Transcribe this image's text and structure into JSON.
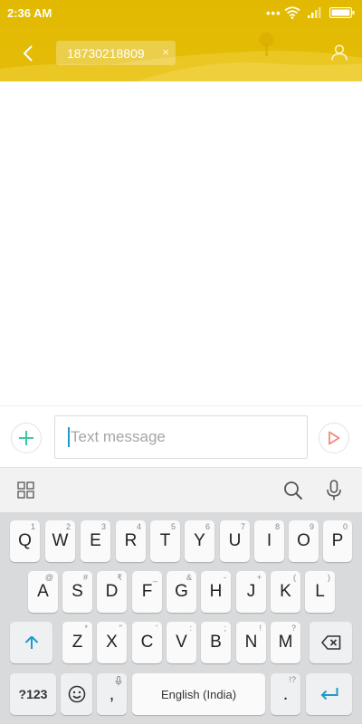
{
  "status_bar": {
    "time": "2:36 AM",
    "dots": "•••"
  },
  "header": {
    "recipient": "18730218809",
    "remove_symbol": "×"
  },
  "composer": {
    "placeholder": "Text message"
  },
  "keyboard": {
    "row1": [
      {
        "label": "Q",
        "hint": "1"
      },
      {
        "label": "W",
        "hint": "2"
      },
      {
        "label": "E",
        "hint": "3"
      },
      {
        "label": "R",
        "hint": "4"
      },
      {
        "label": "T",
        "hint": "5"
      },
      {
        "label": "Y",
        "hint": "6"
      },
      {
        "label": "U",
        "hint": "7"
      },
      {
        "label": "I",
        "hint": "8"
      },
      {
        "label": "O",
        "hint": "9"
      },
      {
        "label": "P",
        "hint": "0"
      }
    ],
    "row2": [
      {
        "label": "A",
        "hint": "@"
      },
      {
        "label": "S",
        "hint": "#"
      },
      {
        "label": "D",
        "hint": "₹"
      },
      {
        "label": "F",
        "hint": "_"
      },
      {
        "label": "G",
        "hint": "&"
      },
      {
        "label": "H",
        "hint": "-"
      },
      {
        "label": "J",
        "hint": "+"
      },
      {
        "label": "K",
        "hint": "("
      },
      {
        "label": "L",
        "hint": ")"
      }
    ],
    "row3": [
      {
        "label": "Z",
        "hint": "*"
      },
      {
        "label": "X",
        "hint": "\""
      },
      {
        "label": "C",
        "hint": "'"
      },
      {
        "label": "V",
        "hint": ":"
      },
      {
        "label": "B",
        "hint": ";"
      },
      {
        "label": "N",
        "hint": "!"
      },
      {
        "label": "M",
        "hint": "?"
      }
    ],
    "symbols_label": "?123",
    "comma_label": ",",
    "space_label": "English (India)",
    "period_label": ".",
    "period_hint": "!?"
  },
  "colors": {
    "header": "#e2b900",
    "accent": "#1f9aca",
    "add_icon": "#3cc9a0",
    "send_icon": "#f08a7a"
  },
  "icons": [
    "back-icon",
    "close-icon",
    "contact-icon",
    "add-icon",
    "send-icon",
    "apps-icon",
    "search-icon",
    "mic-icon",
    "shift-icon",
    "backspace-icon",
    "emoji-icon",
    "enter-icon"
  ]
}
